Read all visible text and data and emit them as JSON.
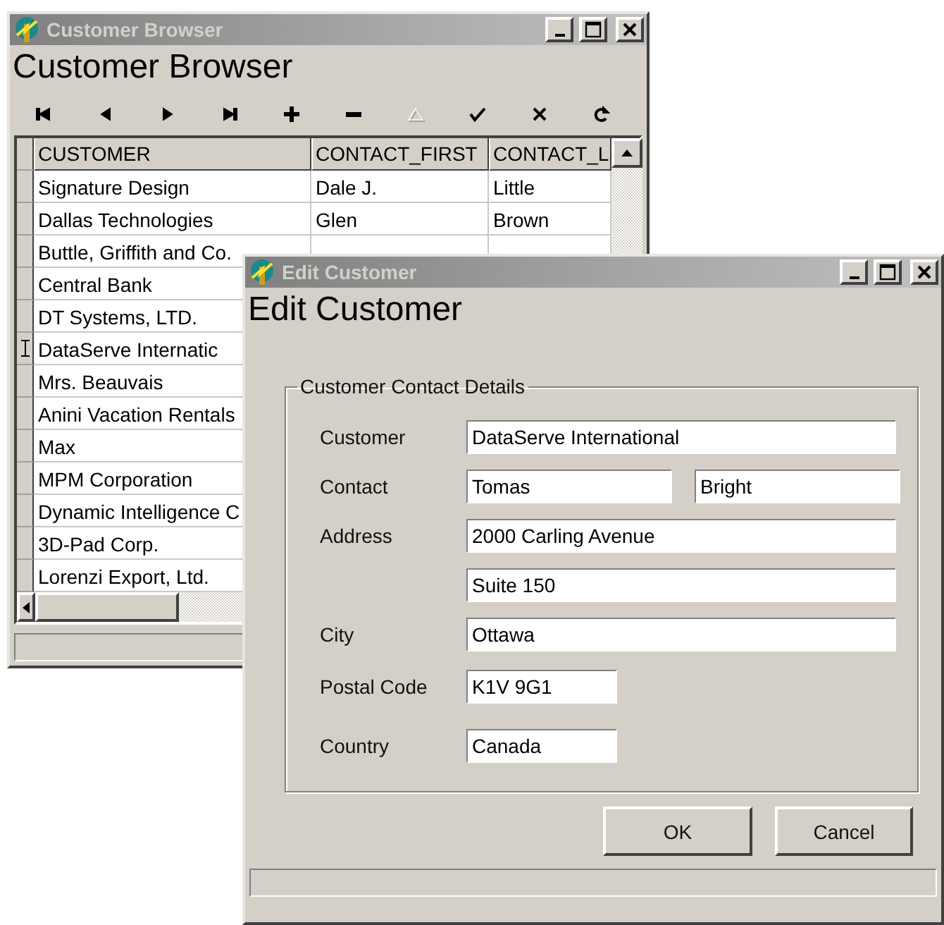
{
  "browser": {
    "title": "Customer Browser",
    "heading": "Customer Browser",
    "toolbar": [
      {
        "kind": "first",
        "disabled": false
      },
      {
        "kind": "prev",
        "disabled": false
      },
      {
        "kind": "next",
        "disabled": false
      },
      {
        "kind": "last",
        "disabled": false
      },
      {
        "kind": "add",
        "disabled": false
      },
      {
        "kind": "delete",
        "disabled": false
      },
      {
        "kind": "edit",
        "disabled": true
      },
      {
        "kind": "post",
        "disabled": false
      },
      {
        "kind": "cancel",
        "disabled": false
      },
      {
        "kind": "refresh",
        "disabled": false
      }
    ],
    "columns": [
      "CUSTOMER",
      "CONTACT_FIRST",
      "CONTACT_L"
    ],
    "rows": [
      {
        "cells": [
          "Signature Design",
          "Dale J.",
          "Little"
        ],
        "current": false
      },
      {
        "cells": [
          "Dallas Technologies",
          "Glen",
          "Brown"
        ],
        "current": false
      },
      {
        "cells": [
          "Buttle, Griffith and Co."
        ],
        "current": false
      },
      {
        "cells": [
          "Central Bank"
        ],
        "current": false
      },
      {
        "cells": [
          "DT Systems, LTD."
        ],
        "current": false
      },
      {
        "cells": [
          "DataServe Internatic"
        ],
        "current": true
      },
      {
        "cells": [
          "Mrs. Beauvais"
        ],
        "current": false
      },
      {
        "cells": [
          "Anini Vacation Rentals"
        ],
        "current": false
      },
      {
        "cells": [
          "Max"
        ],
        "current": false
      },
      {
        "cells": [
          "MPM Corporation"
        ],
        "current": false
      },
      {
        "cells": [
          "Dynamic Intelligence C"
        ],
        "current": false
      },
      {
        "cells": [
          "3D-Pad Corp."
        ],
        "current": false
      },
      {
        "cells": [
          "Lorenzi Export, Ltd."
        ],
        "current": false
      }
    ]
  },
  "editor": {
    "title": "Edit Customer",
    "heading": "Edit Customer",
    "group": "Customer Contact Details",
    "fields": [
      {
        "label": "Customer",
        "inputs": [
          {
            "value": "DataServe International",
            "kind": "wide"
          }
        ]
      },
      {
        "label": "Contact",
        "inputs": [
          {
            "value": "Tomas",
            "kind": "half"
          },
          {
            "value": "Bright",
            "kind": "half"
          }
        ]
      },
      {
        "label": "Address",
        "inputs": [
          {
            "value": "2000 Carling Avenue",
            "kind": "wide"
          }
        ]
      },
      {
        "inputs": [
          {
            "value": "Suite 150",
            "kind": "wide"
          }
        ]
      },
      {
        "label": "City",
        "inputs": [
          {
            "value": "Ottawa",
            "kind": "wide"
          }
        ]
      },
      {
        "label": "Postal Code",
        "inputs": [
          {
            "value": "K1V 9G1",
            "kind": "short"
          }
        ]
      },
      {
        "label": "Country",
        "inputs": [
          {
            "value": "Canada",
            "kind": "short"
          }
        ]
      }
    ],
    "buttons": [
      "OK",
      "Cancel"
    ]
  }
}
